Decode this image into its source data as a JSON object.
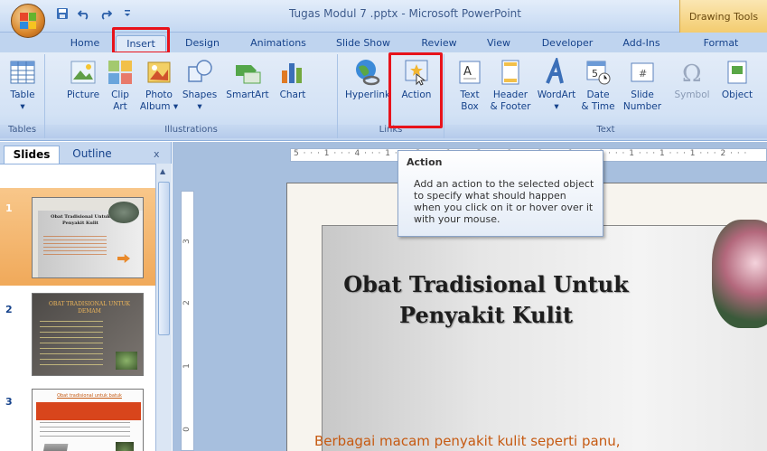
{
  "app": {
    "title": "Tugas Modul 7 .pptx - Microsoft PowerPoint",
    "contextual_tab": "Drawing Tools"
  },
  "qat": {
    "save_icon": "save-icon",
    "undo_icon": "undo-icon",
    "redo_icon": "redo-icon",
    "customize_icon": "customize-qat-icon"
  },
  "tabs": [
    {
      "label": "Home"
    },
    {
      "label": "Insert"
    },
    {
      "label": "Design"
    },
    {
      "label": "Animations"
    },
    {
      "label": "Slide Show"
    },
    {
      "label": "Review"
    },
    {
      "label": "View"
    },
    {
      "label": "Developer"
    },
    {
      "label": "Add-Ins"
    },
    {
      "label": "Format"
    }
  ],
  "ribbon": {
    "groups": {
      "tables": "Tables",
      "illustrations": "Illustrations",
      "links": "Links",
      "text": "Text"
    },
    "buttons": {
      "table": "Table",
      "picture": "Picture",
      "clip_art_1": "Clip",
      "clip_art_2": "Art",
      "photo_album_1": "Photo",
      "photo_album_2": "Album",
      "shapes": "Shapes",
      "smartart": "SmartArt",
      "chart": "Chart",
      "hyperlink": "Hyperlink",
      "action": "Action",
      "text_box_1": "Text",
      "text_box_2": "Box",
      "header_footer_1": "Header",
      "header_footer_2": "& Footer",
      "wordart": "WordArt",
      "date_time_1": "Date",
      "date_time_2": "& Time",
      "slide_number_1": "Slide",
      "slide_number_2": "Number",
      "symbol": "Symbol",
      "object": "Object"
    }
  },
  "tooltip": {
    "title": "Action",
    "body": "Add an action to the selected object to specify what should happen when you click on it or hover over it with your mouse."
  },
  "left_panel": {
    "tab_slides": "Slides",
    "tab_outline": "Outline",
    "close": "x",
    "slides": [
      {
        "number": "1",
        "title": "Obat Tradisional Untuk Penyakit Kulit"
      },
      {
        "number": "2",
        "title": "OBAT TRADISIONAL UNTUK DEMAM"
      },
      {
        "number": "3",
        "title": "Obat tradisional untuk batuk"
      }
    ]
  },
  "rulers": {
    "horizontal": "5 · · · 1 · · · 4 · · · 1 · · · 3 · · · 1 · · · 2 · · · 1 · · · 1 · · · 1 · · · 0 · · · 1 · · · 1 · · · 1 · · · 2 · · ·",
    "vertical": [
      "3",
      "2",
      "1",
      "0"
    ]
  },
  "slide": {
    "title": "Obat Tradisional Untuk Penyakit Kulit",
    "subtitle": "Berbagai macam penyakit kulit seperti panu,"
  },
  "colors": {
    "highlight": "#e8131b",
    "subtitle": "#c65a12"
  }
}
